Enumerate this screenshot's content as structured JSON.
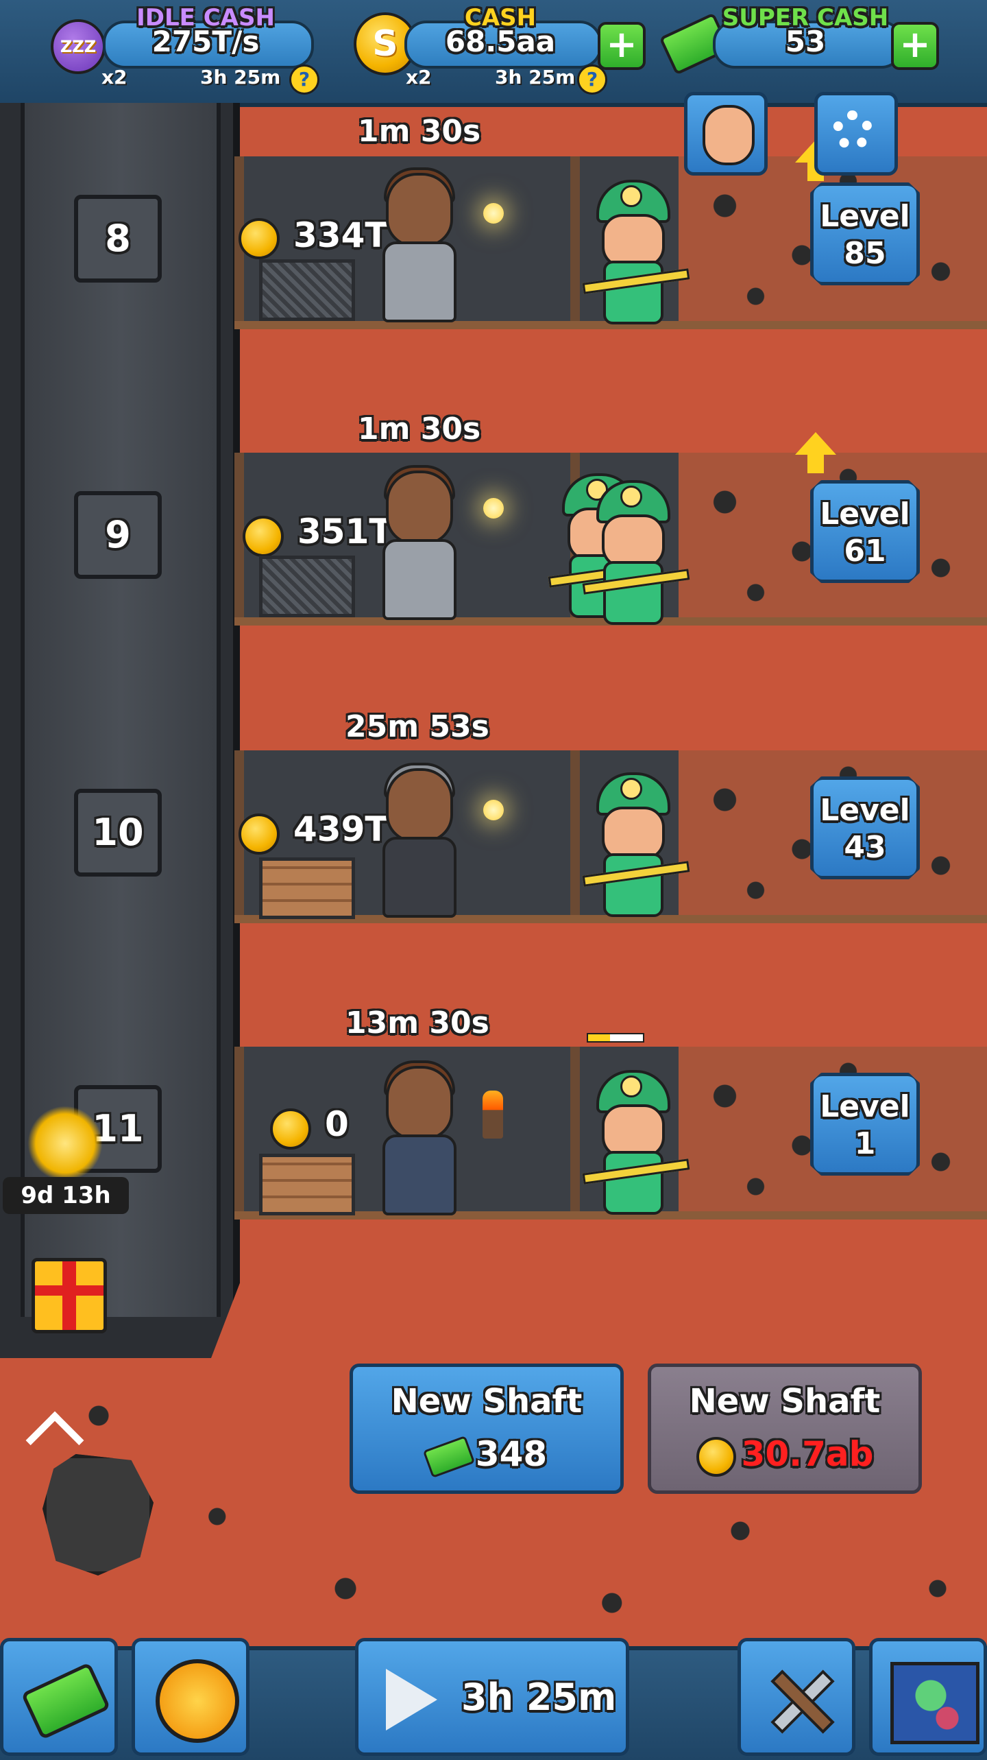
{
  "topbar": {
    "idle_cash": {
      "title": "IDLE CASH",
      "value": "275T/s",
      "multiplier": "x2",
      "timer": "3h 25m"
    },
    "cash": {
      "title": "CASH",
      "value": "68.5aa",
      "multiplier": "x2",
      "timer": "3h 25m"
    },
    "super_cash": {
      "title": "SUPER CASH",
      "value": "53"
    },
    "plus_label": "+",
    "help_label": "?",
    "coin_symbol": "S",
    "idle_icon_text": "ZZZ"
  },
  "elevator": {
    "floors": [
      "8",
      "9",
      "10",
      "11"
    ]
  },
  "shafts": [
    {
      "timer": "1m 30s",
      "money": "334T",
      "level_label": "Level",
      "level": "85",
      "upgrade_available": true
    },
    {
      "timer": "1m 30s",
      "money": "351T",
      "level_label": "Level",
      "level": "61",
      "upgrade_available": true
    },
    {
      "timer": "25m 53s",
      "money": "439T",
      "level_label": "Level",
      "level": "43",
      "upgrade_available": false
    },
    {
      "timer": "13m 30s",
      "money": "0",
      "level_label": "Level",
      "level": "1",
      "upgrade_available": false
    }
  ],
  "event": {
    "countdown": "9d 13h"
  },
  "new_shaft_super": {
    "label": "New Shaft",
    "price": "348"
  },
  "new_shaft_cash": {
    "label": "New Shaft",
    "price": "30.7ab"
  },
  "bottombar": {
    "boost_timer": "3h 25m"
  },
  "icons": {
    "idle": "idle-cash-icon",
    "coin": "coin-icon",
    "super_cash": "super-cash-icon",
    "manager": "manager-icon",
    "settings": "gear-icon",
    "gift": "gift-icon",
    "bells": "bells-icon",
    "shop": "cash-stack-icon",
    "boost": "lightning-badge-icon",
    "play": "play-icon",
    "mine": "pickaxe-shovel-icon",
    "map": "map-icon"
  },
  "colors": {
    "dirt": "#c8553a",
    "ui_blue": "#2c79c4",
    "gold": "#f5b400",
    "green": "#2fae2b",
    "price_red": "#ff2020"
  }
}
